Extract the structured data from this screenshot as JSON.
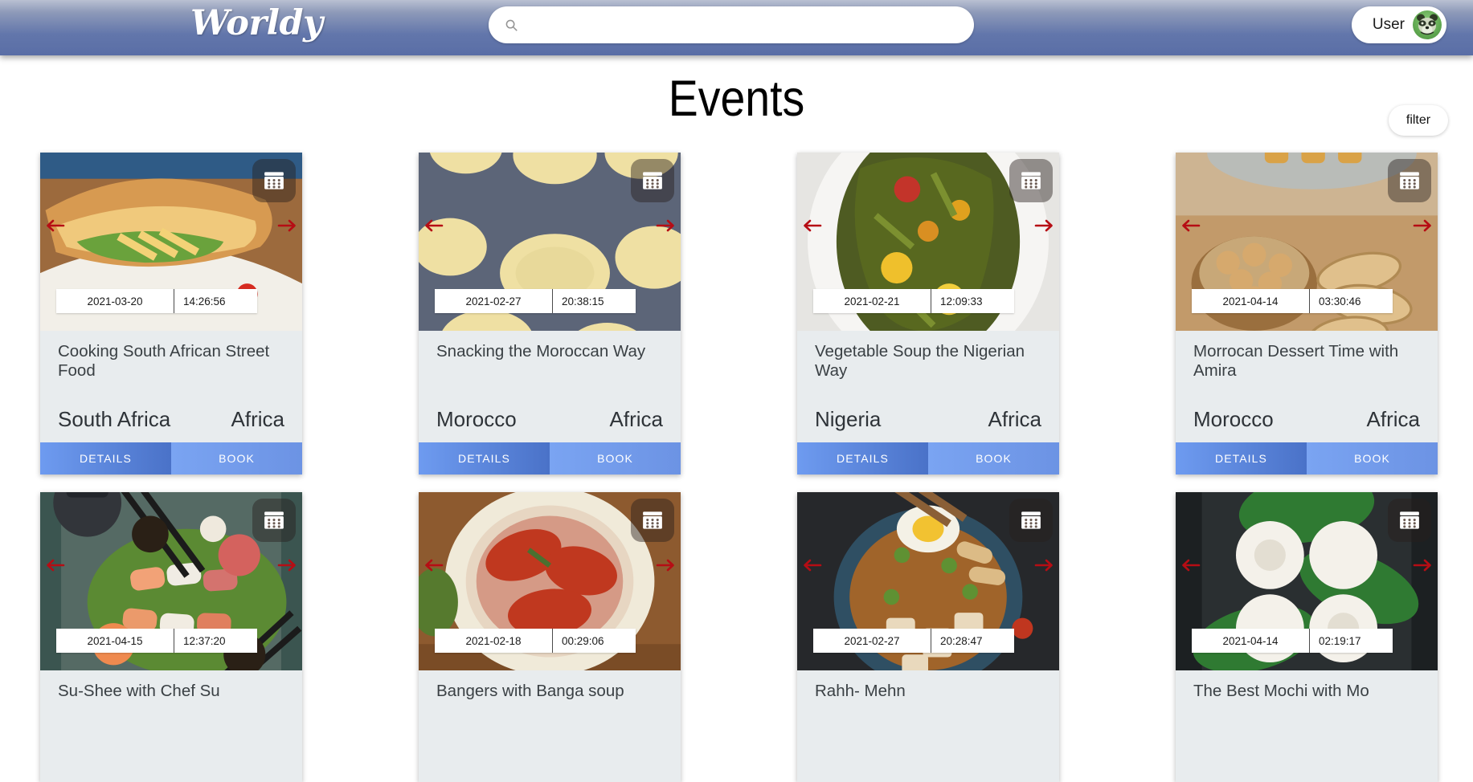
{
  "header": {
    "brand": "Worldy",
    "search": {
      "value": "",
      "placeholder": "",
      "icon": "search-icon"
    },
    "user": {
      "label": "User",
      "avatar_icon": "raccoon-avatar-icon"
    },
    "gradient_top": "#b9c0d2",
    "gradient_bottom": "#5a6ea6"
  },
  "page": {
    "title": "Events",
    "filter_label": "filter"
  },
  "card_actions": {
    "details_label": "DETAILS",
    "book_label": "BOOK",
    "details_color": "#4a72c8",
    "book_color": "#7aa4f2",
    "arrow_color": "#b60d14",
    "card_bg": "#e8ecee"
  },
  "events": [
    {
      "title": "Cooking South African Street Food",
      "country": "South Africa",
      "continent": "Africa",
      "date": "2021-03-20",
      "time": "14:26:56",
      "image": "baguette-sandwich-on-plate",
      "has_actions": true
    },
    {
      "title": "Snacking the Moroccan Way",
      "country": "Morocco",
      "continent": "Africa",
      "date": "2021-02-27",
      "time": "20:38:15",
      "image": "semolina-flatbread-rounds",
      "has_actions": true
    },
    {
      "title": "Vegetable Soup the Nigerian Way",
      "country": "Nigeria",
      "continent": "Africa",
      "date": "2021-02-21",
      "time": "12:09:33",
      "image": "green-vegetable-stew-bowl",
      "has_actions": true
    },
    {
      "title": "Morrocan Dessert Time with Amira",
      "country": "Morocco",
      "continent": "Africa",
      "date": "2021-04-14",
      "time": "03:30:46",
      "image": "nuts-and-biscotti-with-tea",
      "has_actions": true
    },
    {
      "title": "Su-Shee with Chef Su",
      "country": "",
      "continent": "",
      "date": "2021-04-15",
      "time": "12:37:20",
      "image": "sushi-platter-with-teapot",
      "has_actions": false
    },
    {
      "title": "Bangers with Banga soup",
      "country": "",
      "continent": "",
      "date": "2021-02-18",
      "time": "00:29:06",
      "image": "fish-in-red-stew-bowl",
      "has_actions": false
    },
    {
      "title": "Rahh- Mehn",
      "country": "",
      "continent": "",
      "date": "2021-02-27",
      "time": "20:28:47",
      "image": "ramen-bowl-with-egg",
      "has_actions": false
    },
    {
      "title": "The Best Mochi with Mo",
      "country": "",
      "continent": "",
      "date": "2021-04-14",
      "time": "02:19:17",
      "image": "mochi-with-green-leaves",
      "has_actions": false
    }
  ]
}
